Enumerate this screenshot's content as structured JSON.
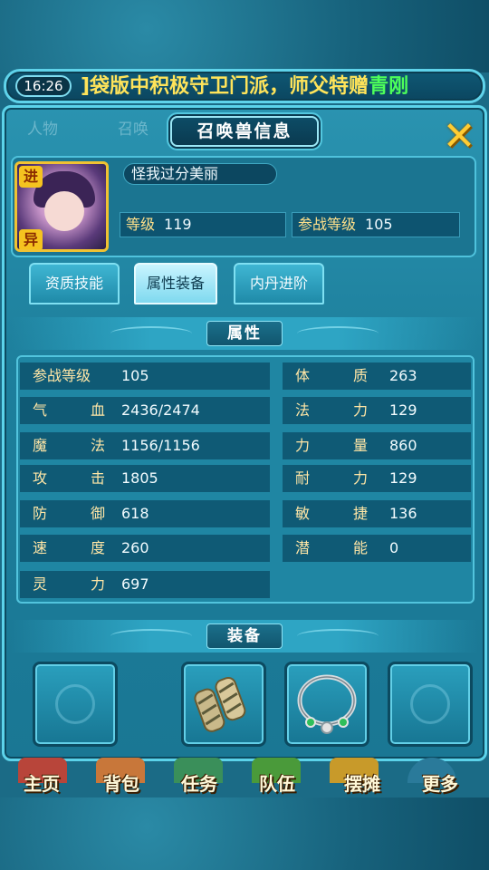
{
  "status": {
    "clock": "16:26",
    "marquee_main": "]袋版中积极守卫门派，师父特赠",
    "marquee_highlight": "青刚"
  },
  "window": {
    "title": "召唤兽信息",
    "ghost_tabs": [
      "人物",
      "召唤"
    ]
  },
  "pet": {
    "name": "怪我过分美丽",
    "avatar_tags": [
      "进",
      "异"
    ],
    "level_label": "等级",
    "level_value": "119",
    "battle_level_label": "参战等级",
    "battle_level_value": "105"
  },
  "tabs": [
    "资质技能",
    "属性装备",
    "内丹进阶"
  ],
  "sections": {
    "attributes_title": "属性",
    "equipment_title": "装备"
  },
  "attributes_left": [
    {
      "k": "参战等级",
      "v": "105"
    },
    {
      "k": "气 血",
      "v": "2436/2474"
    },
    {
      "k": "魔 法",
      "v": "1156/1156"
    },
    {
      "k": "攻 击",
      "v": "1805"
    },
    {
      "k": "防 御",
      "v": "618"
    },
    {
      "k": "速 度",
      "v": "260"
    },
    {
      "k": "灵 力",
      "v": "697"
    }
  ],
  "attributes_right": [
    {
      "k": "体 质",
      "v": "263"
    },
    {
      "k": "法 力",
      "v": "129"
    },
    {
      "k": "力 量",
      "v": "860"
    },
    {
      "k": "耐 力",
      "v": "129"
    },
    {
      "k": "敏 捷",
      "v": "136"
    },
    {
      "k": "潜 能",
      "v": "0"
    }
  ],
  "equipment": [
    "empty",
    "armguard",
    "necklace",
    "empty"
  ],
  "nav": [
    "主页",
    "背包",
    "任务",
    "队伍",
    "摆摊",
    "更多"
  ],
  "colors": {
    "panel": "#1d7f9c",
    "accent": "#5cd3ea",
    "gold": "#f0c232",
    "highlight_green": "#4dff5a",
    "marquee_yellow": "#ffe45a"
  }
}
